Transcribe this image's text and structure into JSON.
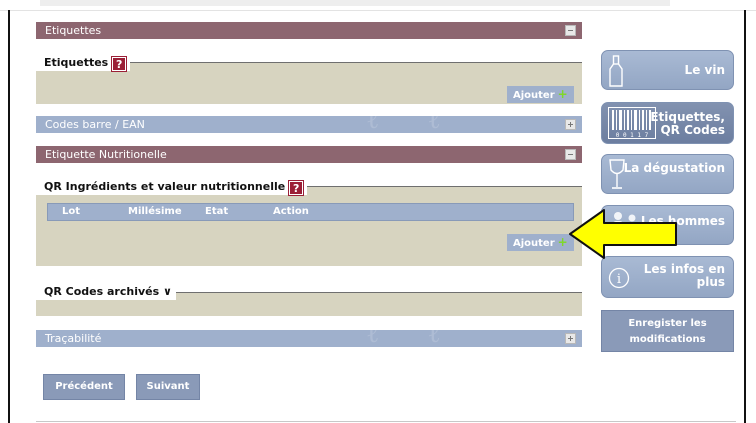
{
  "sections": {
    "etiquettes_bar": "Etiquettes",
    "etiquettes_panel_title": "Etiquettes",
    "codes_barre_bar": "Codes barre / EAN",
    "etiquette_nutri_bar": "Etiquette Nutritionelle",
    "qr_panel_title": "QR Ingrédients et valeur nutritionnelle",
    "qr_archives_title": "QR Codes archivés",
    "tracabilite_bar": "Traçabilité"
  },
  "buttons": {
    "ajouter": "Ajouter",
    "ajouter_qr": "Ajouter",
    "precedent": "Précédent",
    "suivant": "Suivant"
  },
  "help_glyph": "?",
  "plus_glyph": "+",
  "chevron_glyph": "∨",
  "qr_table": {
    "columns": [
      "Lot",
      "Millésime",
      "Etat",
      "Action"
    ]
  },
  "sidebar": {
    "items": [
      {
        "label": "Le vin",
        "icon": "wine-bottle-icon"
      },
      {
        "label_line1": "Etiquettes,",
        "label_line2": "QR Codes",
        "icon": "barcode-icon",
        "barcode_digits": "0 0 1 1 7"
      },
      {
        "label": "La dégustation",
        "icon": "wine-glass-icon"
      },
      {
        "label": "Les hommes",
        "icon": "people-icon"
      },
      {
        "label_line1": "Les infos en",
        "label_line2": "plus",
        "icon": "info-icon",
        "info_glyph": "i"
      }
    ],
    "save_line1": "Enregister les",
    "save_line2": "modifications"
  },
  "colors": {
    "purple_bar": "#8d6670",
    "blue_bar": "#9fb0cc",
    "panel_bg": "#d7d4c0",
    "help_icon": "#9b1f36",
    "arrow_yellow": "#ffff00"
  }
}
